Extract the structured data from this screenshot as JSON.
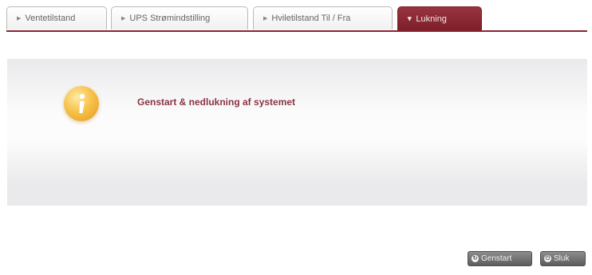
{
  "tabs": [
    {
      "label": "Ventetilstand",
      "active": false
    },
    {
      "label": "UPS Strømindstilling",
      "active": false
    },
    {
      "label": "Hviletilstand Til / Fra",
      "active": false
    },
    {
      "label": "Lukning",
      "active": true
    }
  ],
  "panel": {
    "icon": "info-icon",
    "title": "Genstart & nedlukning af systemet"
  },
  "buttons": {
    "restart_label": "Genstart",
    "restart_icon": "restart-icon",
    "shutdown_label": "Sluk",
    "shutdown_icon": "power-icon"
  },
  "colors": {
    "accent": "#8a2430",
    "title": "#8a3444",
    "button": "#6e6e6e"
  }
}
